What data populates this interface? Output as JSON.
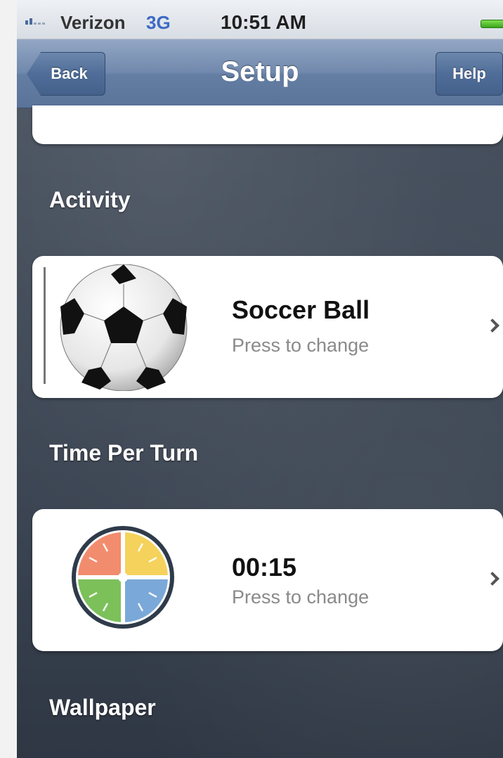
{
  "status_bar": {
    "carrier": "Verizon",
    "network": "3G",
    "time": "10:51 AM"
  },
  "nav": {
    "title": "Setup",
    "back_label": "Back",
    "help_label": "Help"
  },
  "sections": {
    "activity": {
      "label": "Activity",
      "title": "Soccer Ball",
      "subtitle": "Press to change",
      "icon": "soccer-ball-icon"
    },
    "time_per_turn": {
      "label": "Time Per Turn",
      "title": "00:15",
      "subtitle": "Press to change",
      "icon": "timer-icon"
    },
    "wallpaper": {
      "label": "Wallpaper"
    }
  },
  "colors": {
    "nav_bar": "#637da3",
    "network_indicator": "#3c6ac4",
    "battery": "#3aa61c",
    "subtitle_text": "#8a8a8a"
  }
}
